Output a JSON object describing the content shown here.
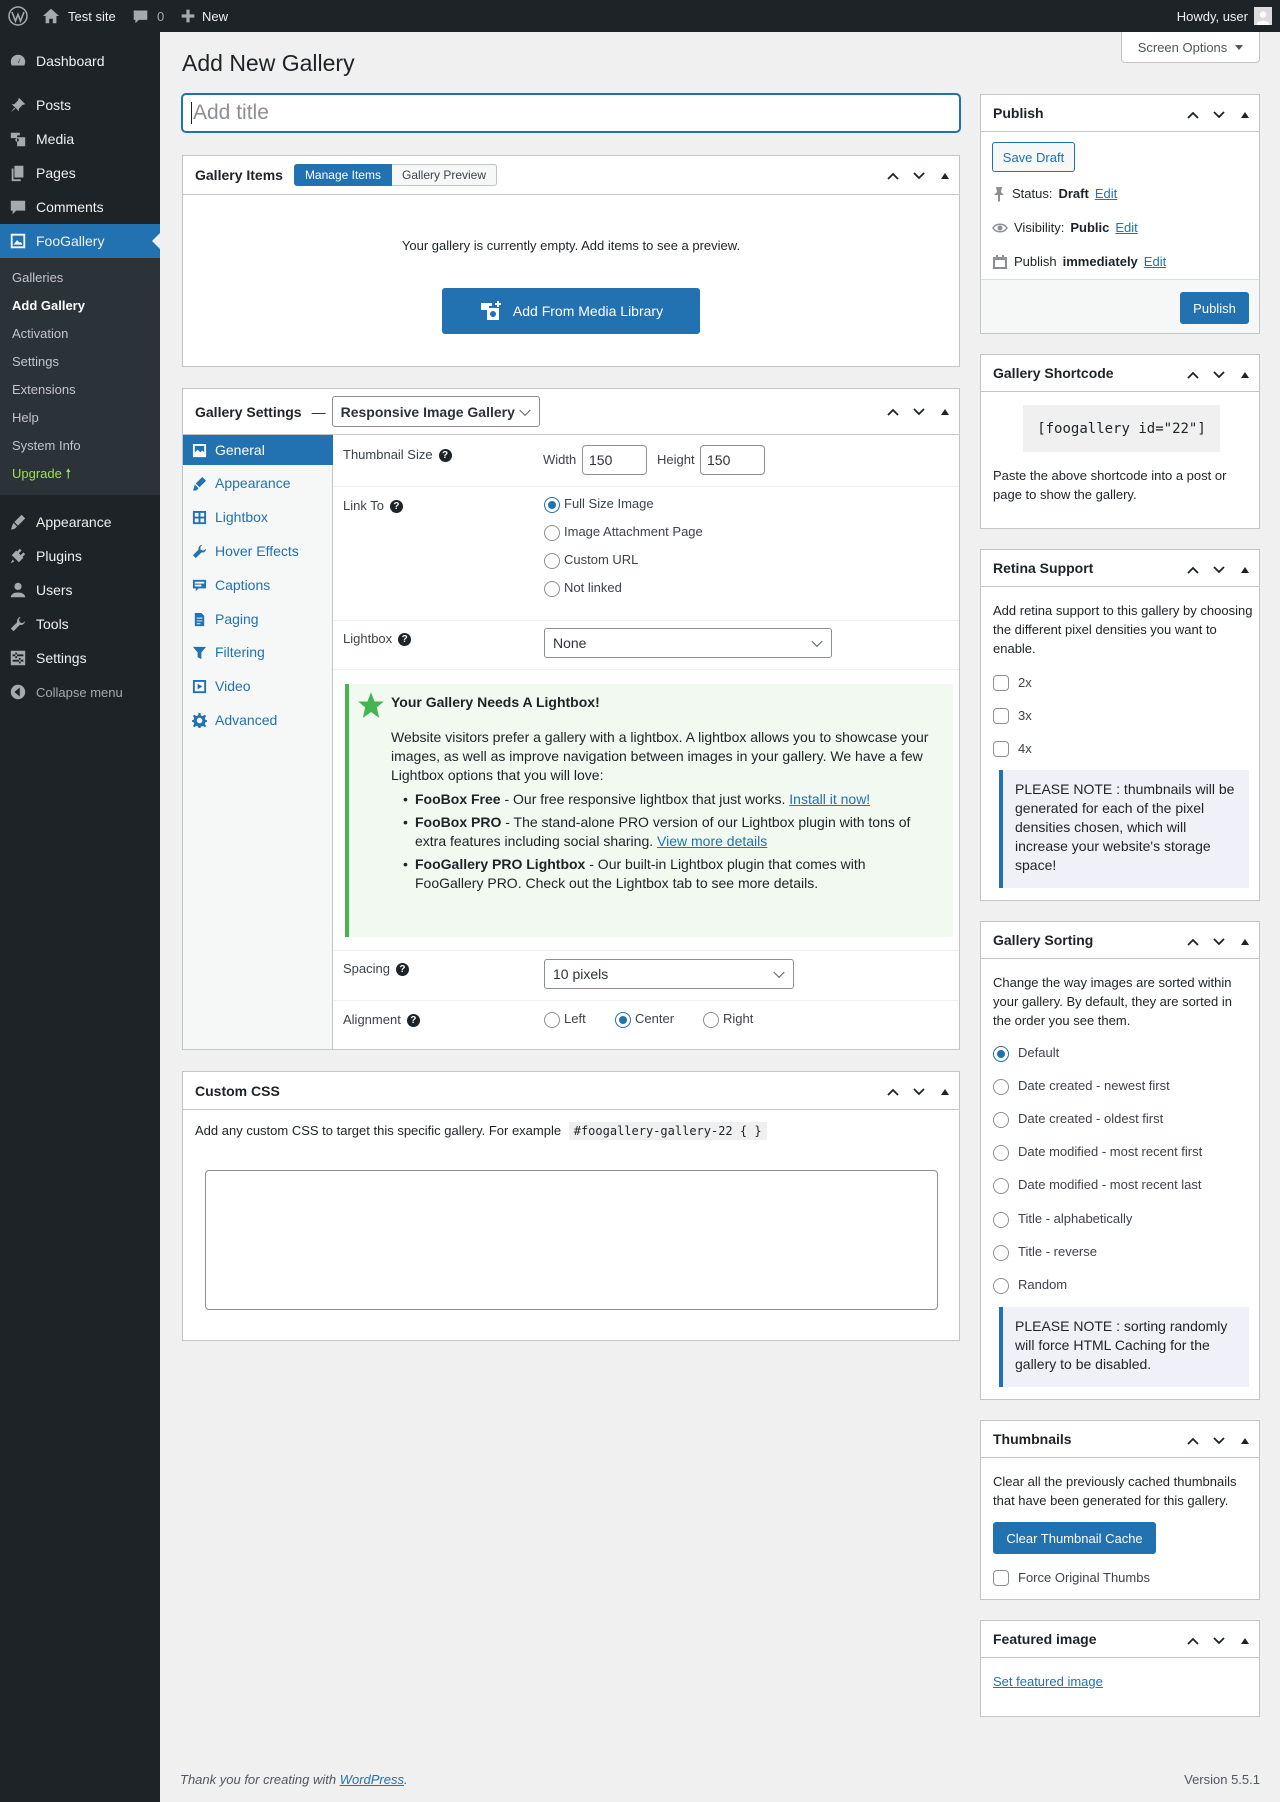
{
  "adminbar": {
    "site_name": "Test site",
    "comments_count": "0",
    "new_label": "New",
    "howdy": "Howdy, user"
  },
  "sidebar": {
    "items": [
      {
        "label": "Dashboard",
        "icon": "dashboard-icon"
      },
      {
        "label": "Posts",
        "icon": "pin-icon"
      },
      {
        "label": "Media",
        "icon": "media-icon"
      },
      {
        "label": "Pages",
        "icon": "pages-icon"
      },
      {
        "label": "Comments",
        "icon": "comment-icon"
      },
      {
        "label": "FooGallery",
        "icon": "gallery-icon"
      },
      {
        "label": "Appearance",
        "icon": "brush-icon"
      },
      {
        "label": "Plugins",
        "icon": "plug-icon"
      },
      {
        "label": "Users",
        "icon": "user-icon"
      },
      {
        "label": "Tools",
        "icon": "wrench-icon"
      },
      {
        "label": "Settings",
        "icon": "settings-icon"
      },
      {
        "label": "Collapse menu",
        "icon": "collapse-icon"
      }
    ],
    "submenu": [
      "Galleries",
      "Add Gallery",
      "Activation",
      "Settings",
      "Extensions",
      "Help",
      "System Info",
      "Upgrade 🠕"
    ]
  },
  "page": {
    "title": "Add New Gallery",
    "screen_options": "Screen Options",
    "title_placeholder": "Add title"
  },
  "gallery_items": {
    "title": "Gallery Items",
    "tab_manage": "Manage Items",
    "tab_preview": "Gallery Preview",
    "empty_text": "Your gallery is currently empty. Add items to see a preview.",
    "add_button": "Add From Media Library"
  },
  "gallery_settings": {
    "title": "Gallery Settings",
    "dash": "—",
    "template": "Responsive Image Gallery",
    "tabs": [
      "General",
      "Appearance",
      "Lightbox",
      "Hover Effects",
      "Captions",
      "Paging",
      "Filtering",
      "Video",
      "Advanced"
    ],
    "thumb_size_label": "Thumbnail Size",
    "width_label": "Width",
    "width_value": "150",
    "height_label": "Height",
    "height_value": "150",
    "link_to_label": "Link To",
    "link_options": [
      "Full Size Image",
      "Image Attachment Page",
      "Custom URL",
      "Not linked"
    ],
    "lightbox_label": "Lightbox",
    "lightbox_value": "None",
    "promo": {
      "title": "Your Gallery Needs A Lightbox!",
      "body": "Website visitors prefer a gallery with a lightbox. A lightbox allows you to showcase your images, as well as improve navigation between images in your gallery. We have a few Lightbox options that you will love:",
      "items": [
        {
          "bold": "FooBox Free",
          "text": " - Our free responsive lightbox that just works. ",
          "link": "Install it now!"
        },
        {
          "bold": "FooBox PRO",
          "text": " - The stand-alone PRO version of our Lightbox plugin with tons of extra features including social sharing. ",
          "link": "View more details"
        },
        {
          "bold": "FooGallery PRO Lightbox",
          "text": " - Our built-in Lightbox plugin that comes with FooGallery PRO. Check out the Lightbox tab to see more details.",
          "link": ""
        }
      ]
    },
    "spacing_label": "Spacing",
    "spacing_value": "10 pixels",
    "alignment_label": "Alignment",
    "alignment_options": [
      "Left",
      "Center",
      "Right"
    ]
  },
  "custom_css": {
    "title": "Custom CSS",
    "desc": "Add any custom CSS to target this specific gallery. For example",
    "example": "#foogallery-gallery-22 { }"
  },
  "publish": {
    "title": "Publish",
    "save_draft": "Save Draft",
    "status_label": "Status:",
    "status_value": "Draft",
    "visibility_label": "Visibility:",
    "visibility_value": "Public",
    "publish_label": "Publish",
    "publish_value": "immediately",
    "edit": "Edit",
    "publish_button": "Publish"
  },
  "shortcode": {
    "title": "Gallery Shortcode",
    "code": "[foogallery id=\"22\"]",
    "desc": "Paste the above shortcode into a post or page to show the gallery."
  },
  "retina": {
    "title": "Retina Support",
    "desc": "Add retina support to this gallery by choosing the different pixel densities you want to enable.",
    "options": [
      "2x",
      "3x",
      "4x"
    ],
    "note": "PLEASE NOTE : thumbnails will be generated for each of the pixel densities chosen, which will increase your website's storage space!"
  },
  "sorting": {
    "title": "Gallery Sorting",
    "desc": "Change the way images are sorted within your gallery. By default, they are sorted in the order you see them.",
    "options": [
      "Default",
      "Date created - newest first",
      "Date created - oldest first",
      "Date modified - most recent first",
      "Date modified - most recent last",
      "Title - alphabetically",
      "Title - reverse",
      "Random"
    ],
    "note": "PLEASE NOTE : sorting randomly will force HTML Caching for the gallery to be disabled."
  },
  "thumbnails": {
    "title": "Thumbnails",
    "desc": "Clear all the previously cached thumbnails that have been generated for this gallery.",
    "clear_button": "Clear Thumbnail Cache",
    "force_label": "Force Original Thumbs"
  },
  "featured": {
    "title": "Featured image",
    "link": "Set featured image"
  },
  "footer": {
    "thanks": "Thank you for creating with ",
    "wp_link": "WordPress",
    "period": ".",
    "version": "Version 5.5.1"
  }
}
